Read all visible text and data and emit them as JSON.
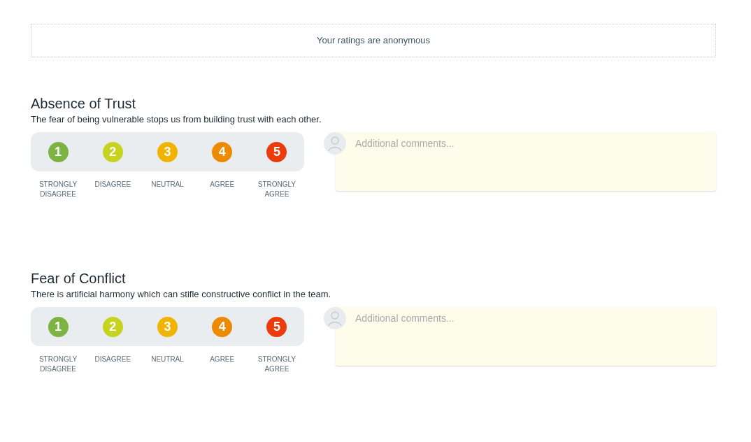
{
  "notice": "Your ratings are anonymous",
  "sections": [
    {
      "title": "Absence of Trust",
      "description": "The fear of being vulnerable stops us from building trust with each other.",
      "options": [
        {
          "number": "1",
          "label": "STRONGLY DISAGREE",
          "color": "#7cb342"
        },
        {
          "number": "2",
          "label": "DISAGREE",
          "color": "#c6d41f"
        },
        {
          "number": "3",
          "label": "NEUTRAL",
          "color": "#f0b400"
        },
        {
          "number": "4",
          "label": "AGREE",
          "color": "#ec8a00"
        },
        {
          "number": "5",
          "label": "STRONGLY AGREE",
          "color": "#ea3c0c"
        }
      ],
      "comment": {
        "placeholder": "Additional comments..."
      }
    },
    {
      "title": "Fear of Conflict",
      "description": "There is artificial harmony which can stifle constructive conflict in the team.",
      "options": [
        {
          "number": "1",
          "label": "STRONGLY DISAGREE",
          "color": "#7cb342"
        },
        {
          "number": "2",
          "label": "DISAGREE",
          "color": "#c6d41f"
        },
        {
          "number": "3",
          "label": "NEUTRAL",
          "color": "#f0b400"
        },
        {
          "number": "4",
          "label": "AGREE",
          "color": "#ec8a00"
        },
        {
          "number": "5",
          "label": "STRONGLY AGREE",
          "color": "#ea3c0c"
        }
      ],
      "comment": {
        "placeholder": "Additional comments..."
      }
    }
  ]
}
